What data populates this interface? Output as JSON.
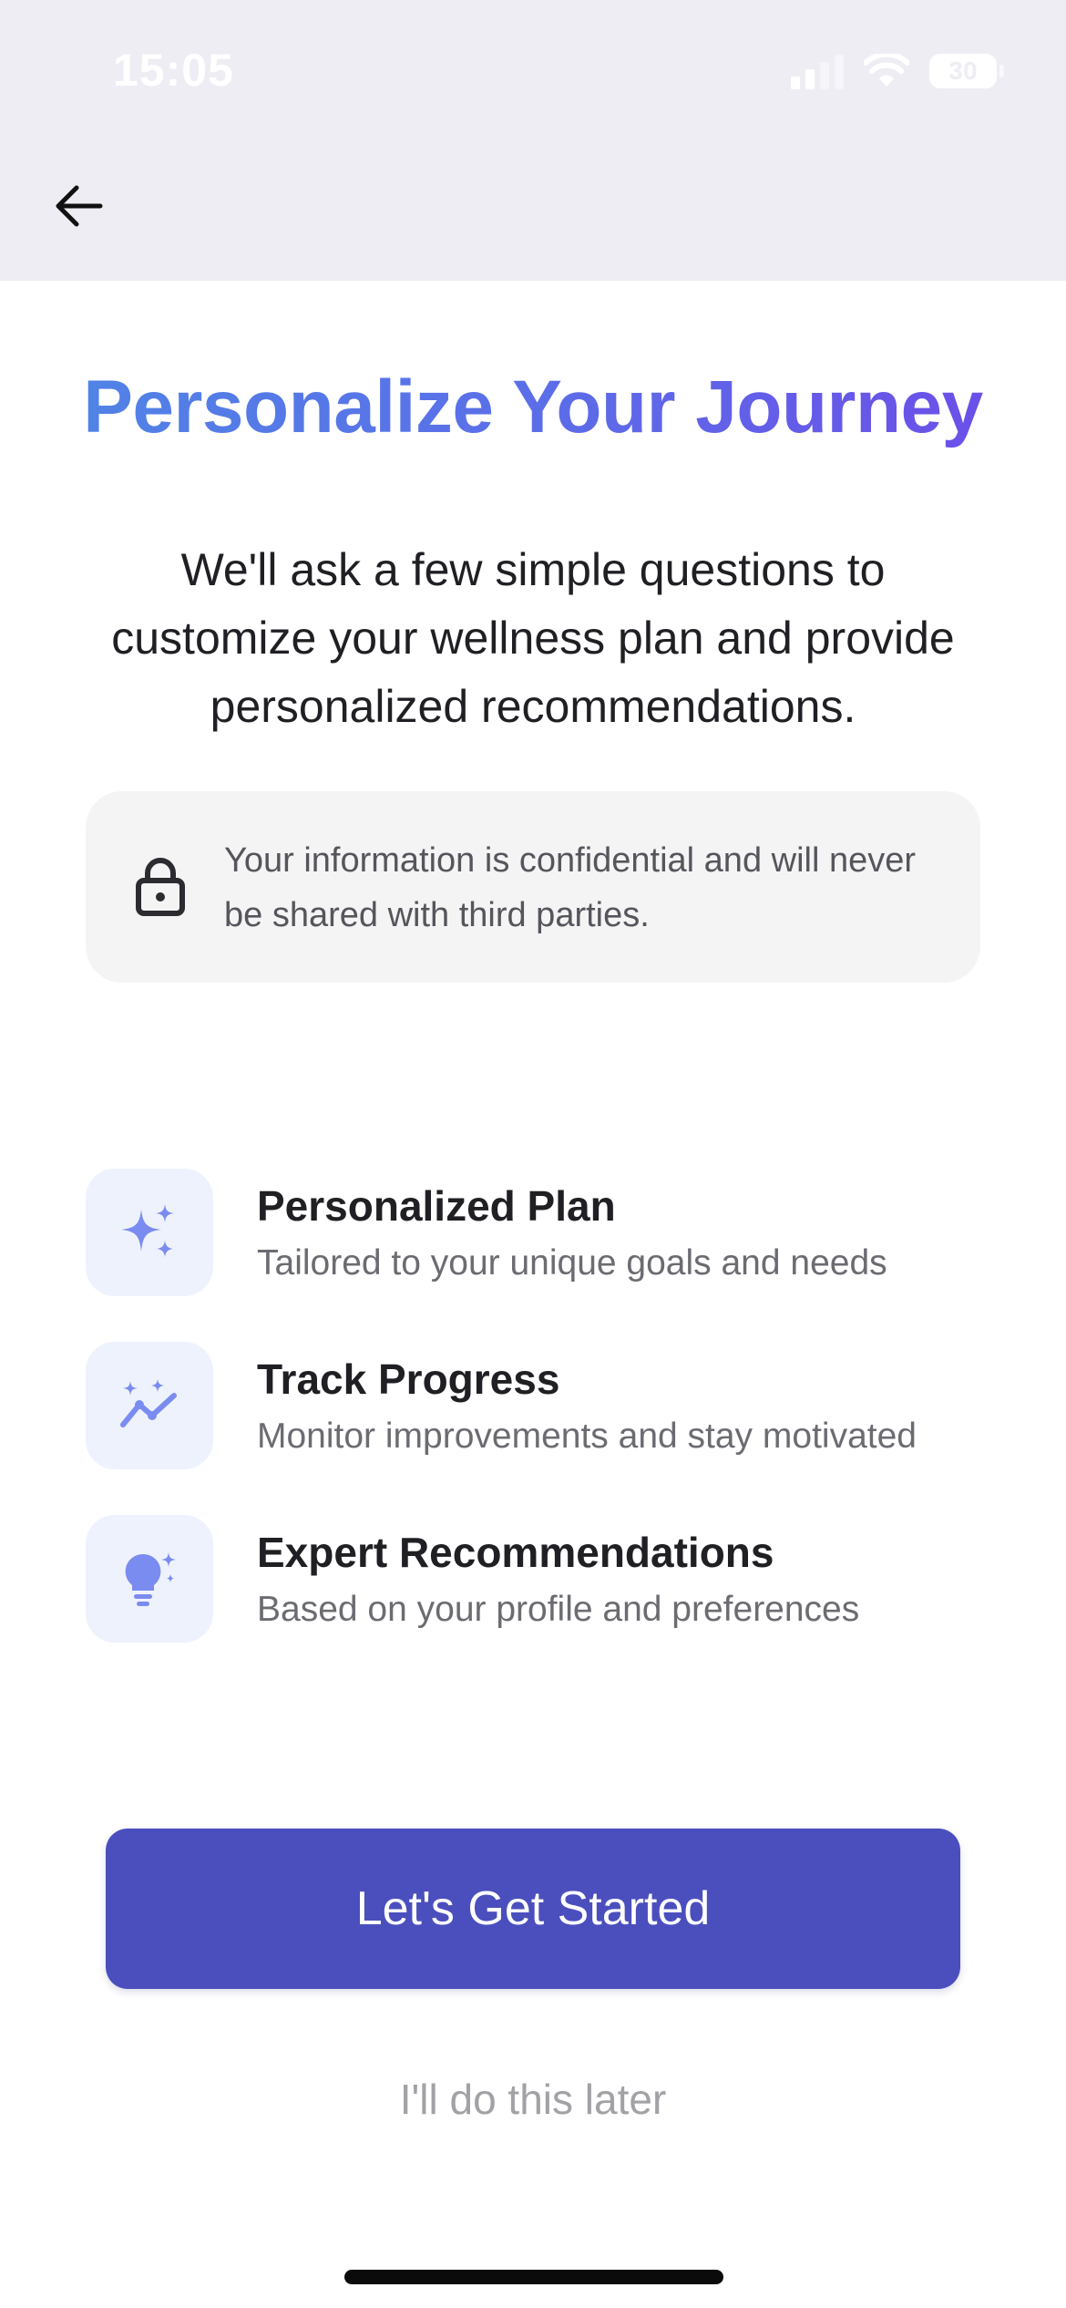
{
  "status_bar": {
    "time": "15:05",
    "battery": "30"
  },
  "header": {
    "back_icon": "arrow-left-icon"
  },
  "main": {
    "title": "Personalize Your Journey",
    "subtitle": "We'll ask a few simple questions to customize your wellness plan and provide personalized recommendations.",
    "privacy": {
      "icon": "lock-icon",
      "text": "Your information is confidential and will never be shared with third parties."
    },
    "features": [
      {
        "icon": "sparkles-icon",
        "title": "Personalized Plan",
        "description": "Tailored to your unique goals and needs"
      },
      {
        "icon": "trending-chart-icon",
        "title": "Track Progress",
        "description": "Monitor improvements and stay motivated"
      },
      {
        "icon": "lightbulb-icon",
        "title": "Expert Recommendations",
        "description": "Based on your profile and preferences"
      }
    ]
  },
  "actions": {
    "primary_label": "Let's Get Started",
    "secondary_label": "I'll do this later"
  },
  "colors": {
    "accent": "#4b4fbd",
    "title_gradient_start": "#4f86e6",
    "title_gradient_end": "#6e4ae8",
    "icon_tint": "#7b8cf0"
  }
}
